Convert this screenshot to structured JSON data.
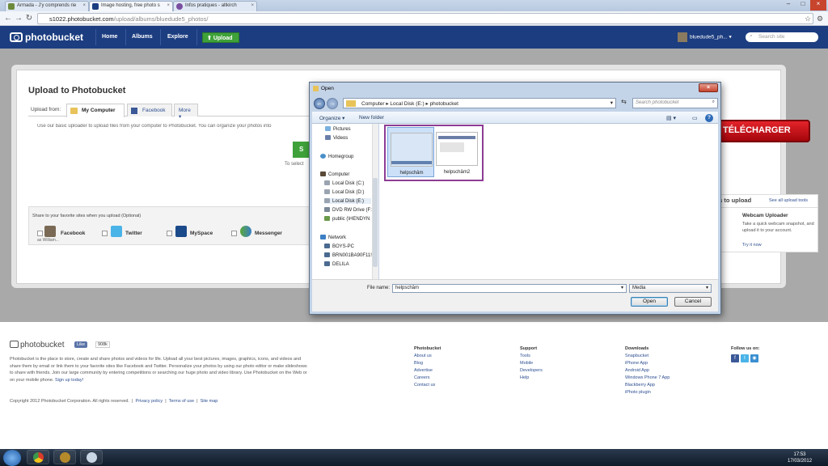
{
  "browser": {
    "tabs": [
      {
        "label": "Armada - J'y comprends rie"
      },
      {
        "label": "Image hosting, free photo s"
      },
      {
        "label": "Infos pratiques - altkirch"
      }
    ],
    "url_host": "s1022.photobucket.com",
    "url_path": "/upload/albums/bluedude5_photos/",
    "win_min": "–",
    "win_max": "□",
    "win_close": "×"
  },
  "header": {
    "logo": "photobucket",
    "nav": [
      "Home",
      "Albums",
      "Explore"
    ],
    "upload": "Upload",
    "user": "bluedude5_ph...",
    "search_placeholder": "Search site"
  },
  "upload": {
    "title": "Upload to Photobucket",
    "from_label": "Upload from:",
    "tabs": [
      "My Computer",
      "Facebook",
      "More"
    ],
    "description": "Use our basic uploader to upload files from your computer to Photobucket. You can organize your photos into",
    "button_partial": "S",
    "to_select": "To select"
  },
  "share": {
    "title": "Share to your favorite sites when you upload (Optional)",
    "sites": [
      "Facebook",
      "Twitter",
      "MySpace",
      "Messenger"
    ],
    "as_user": "as William..."
  },
  "right": {
    "download": "TÉLÉCHARGER",
    "ways_title": "ys to upload",
    "see_all": "See all upload tools",
    "webcam_title": "Webcam Uploader",
    "webcam_desc": "Take a quick webcam snapshot, and upload it to your account.",
    "try_now": "Try it now"
  },
  "dialog": {
    "title": "Open",
    "path": [
      "Computer",
      "Local Disk (E:)",
      "photobucket"
    ],
    "search_placeholder": "Search photobucket",
    "organize": "Organize",
    "new_folder": "New folder",
    "nav_items": [
      "Pictures",
      "Videos",
      "Homegroup",
      "Computer",
      "Local Disk (C:)",
      "Local Disk (D:)",
      "Local Disk (E:)",
      "DVD RW Drive (F:",
      "public (\\HENDYN",
      "Network",
      "BOYS-PC",
      "BRN001BA90F11!",
      "DELILA"
    ],
    "files": [
      "helpschâm",
      "helpschâm2"
    ],
    "file_name_label": "File name:",
    "file_name_value": "helpschâm",
    "file_type": "Media",
    "open": "Open",
    "cancel": "Cancel"
  },
  "footer": {
    "logo": "photobucket",
    "like": "Like",
    "like_count": "908k",
    "text_part1": "Photobucket is the place to store, create and share photos and videos for life. Upload all your best pictures, images, graphics, icons, and videos and share them by email or link them to your favorite sites like Facebook and Twitter. Personalize your photos by using our photo editor or make slideshows to share with friends. Join our large community by entering competitions or searching our huge photo and video library. Use Photobucket on the Web or on your mobile phone.",
    "signup": "Sign up today!",
    "copyright": "Copyright 2012 Photobucket Corporation.  All rights reserved.",
    "links": [
      "Privacy policy",
      "Terms of use",
      "Site map"
    ],
    "col_photobucket": {
      "title": "Photobucket",
      "items": [
        "About us",
        "Blog",
        "Advertise",
        "Careers",
        "Contact us"
      ]
    },
    "col_support": {
      "title": "Support",
      "items": [
        "Tools",
        "Mobile",
        "Developers",
        "Help"
      ]
    },
    "col_downloads": {
      "title": "Downloads",
      "items": [
        "Snapbucket",
        "iPhone App",
        "Android App",
        "Windows Phone 7 App",
        "Blackberry App",
        "iPhoto plugin"
      ]
    },
    "follow": "Follow us on:"
  },
  "taskbar": {
    "time": "17:53",
    "date": "17/03/2012"
  },
  "colors": {
    "brand": "#1c3d80",
    "upload_green": "#3fa13a",
    "selection_outline": "#8d3d94"
  }
}
